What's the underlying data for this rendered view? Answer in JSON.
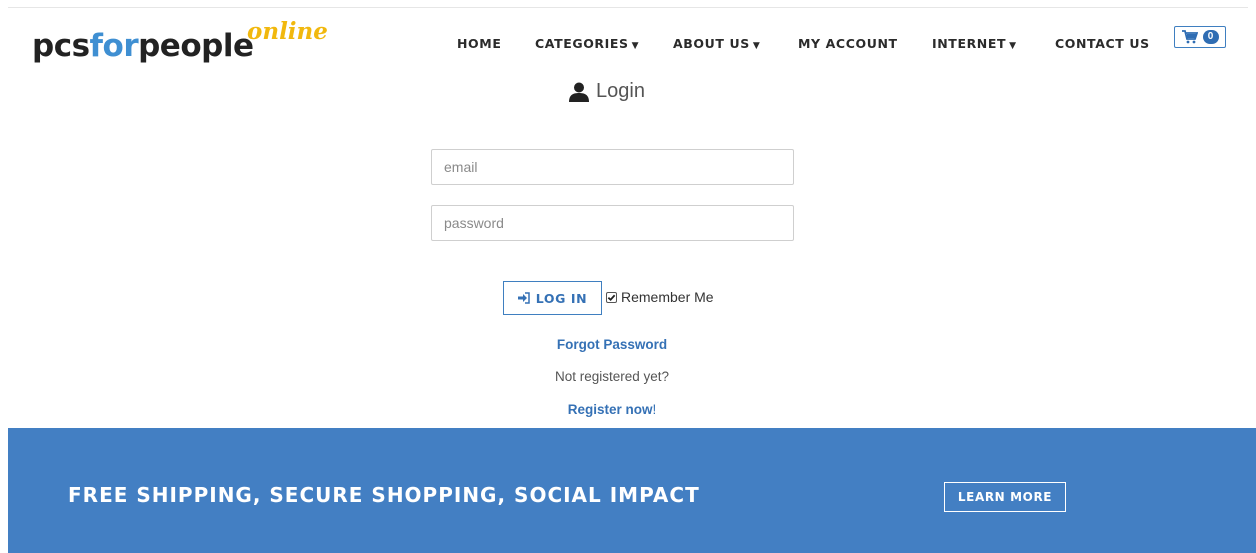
{
  "logo": {
    "part1": "pcs",
    "part2": "for",
    "part3": "people",
    "suffix": "online"
  },
  "nav": {
    "items": [
      {
        "label": "HOME",
        "dropdown": false
      },
      {
        "label": "CATEGORIES",
        "dropdown": true
      },
      {
        "label": "ABOUT US",
        "dropdown": true
      },
      {
        "label": "MY ACCOUNT",
        "dropdown": false
      },
      {
        "label": "INTERNET",
        "dropdown": true
      },
      {
        "label": "CONTACT US",
        "dropdown": false
      }
    ],
    "caret": "▼",
    "cart_count": "0"
  },
  "login": {
    "title": "Login",
    "email_placeholder": "email",
    "password_placeholder": "password",
    "button_label": "LOG IN",
    "remember_label": "Remember Me",
    "remember_checked": true,
    "forgot_link": "Forgot Password",
    "not_registered": "Not registered yet?",
    "register_link": "Register now",
    "register_suffix": "!"
  },
  "banner": {
    "text": "FREE SHIPPING, SECURE SHOPPING, SOCIAL IMPACT",
    "button_label": "LEARN MORE"
  },
  "colors": {
    "accent": "#3571b5",
    "banner": "#437fc3",
    "logo_for": "#3f8fd2",
    "logo_online": "#f1b80e"
  },
  "icons": {
    "cart": "shopping-cart-icon",
    "user": "user-icon",
    "login": "sign-in-icon",
    "check": "check-icon"
  }
}
